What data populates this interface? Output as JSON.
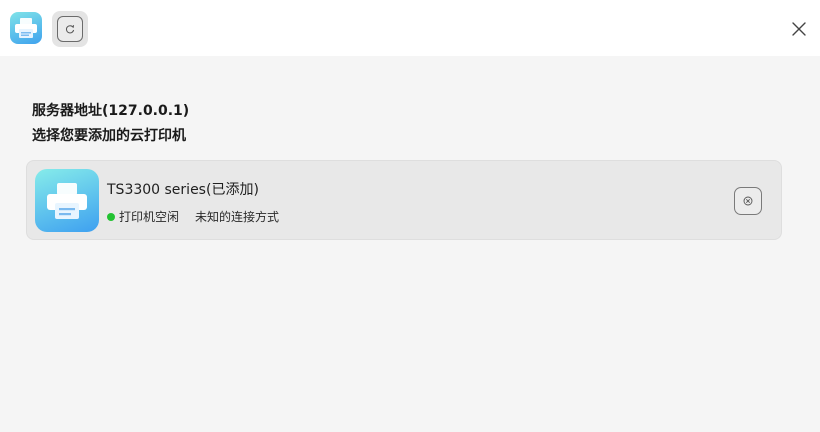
{
  "titlebar": {
    "app_icon": "printer-icon",
    "refresh_icon": "refresh-icon",
    "close_icon": "close-icon"
  },
  "content": {
    "server_address": "服务器地址(127.0.0.1)",
    "instruction": "选择您要添加的云打印机"
  },
  "printers": [
    {
      "name": "TS3300 series(已添加)",
      "status": "打印机空闲",
      "status_color": "#22c232",
      "connection": "未知的连接方式",
      "icon": "printer-icon",
      "action_icon": "remove-icon"
    }
  ]
}
